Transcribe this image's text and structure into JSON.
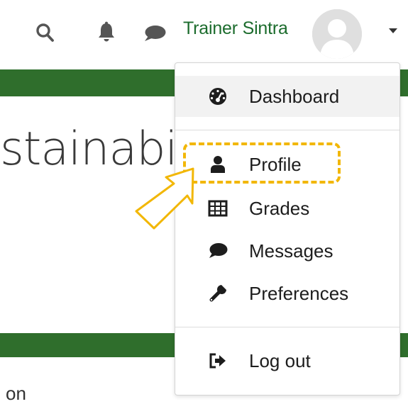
{
  "navbar": {
    "user_name": "Trainer Sintra",
    "icons": [
      "search-icon",
      "bell-icon",
      "chat-icon",
      "avatar",
      "chevron-down-icon"
    ],
    "user_name_color": "#1c6c2d"
  },
  "background": {
    "course_title_fragment": "stainabil",
    "section_text_fragment": "on",
    "band_color": "#2f6e2c"
  },
  "user_menu": {
    "items": [
      {
        "label": "Dashboard",
        "icon": "dashboard-gauge-icon",
        "active": true
      },
      {
        "label": "Profile",
        "icon": "user-icon",
        "active": false
      },
      {
        "label": "Grades",
        "icon": "table-icon",
        "active": false
      },
      {
        "label": "Messages",
        "icon": "speech-bubble-icon",
        "active": false
      },
      {
        "label": "Preferences",
        "icon": "wrench-icon",
        "active": false
      },
      {
        "label": "Log out",
        "icon": "sign-out-icon",
        "active": false
      }
    ]
  },
  "annotation": {
    "highlight_color": "#f2b706",
    "target": "Profile"
  }
}
